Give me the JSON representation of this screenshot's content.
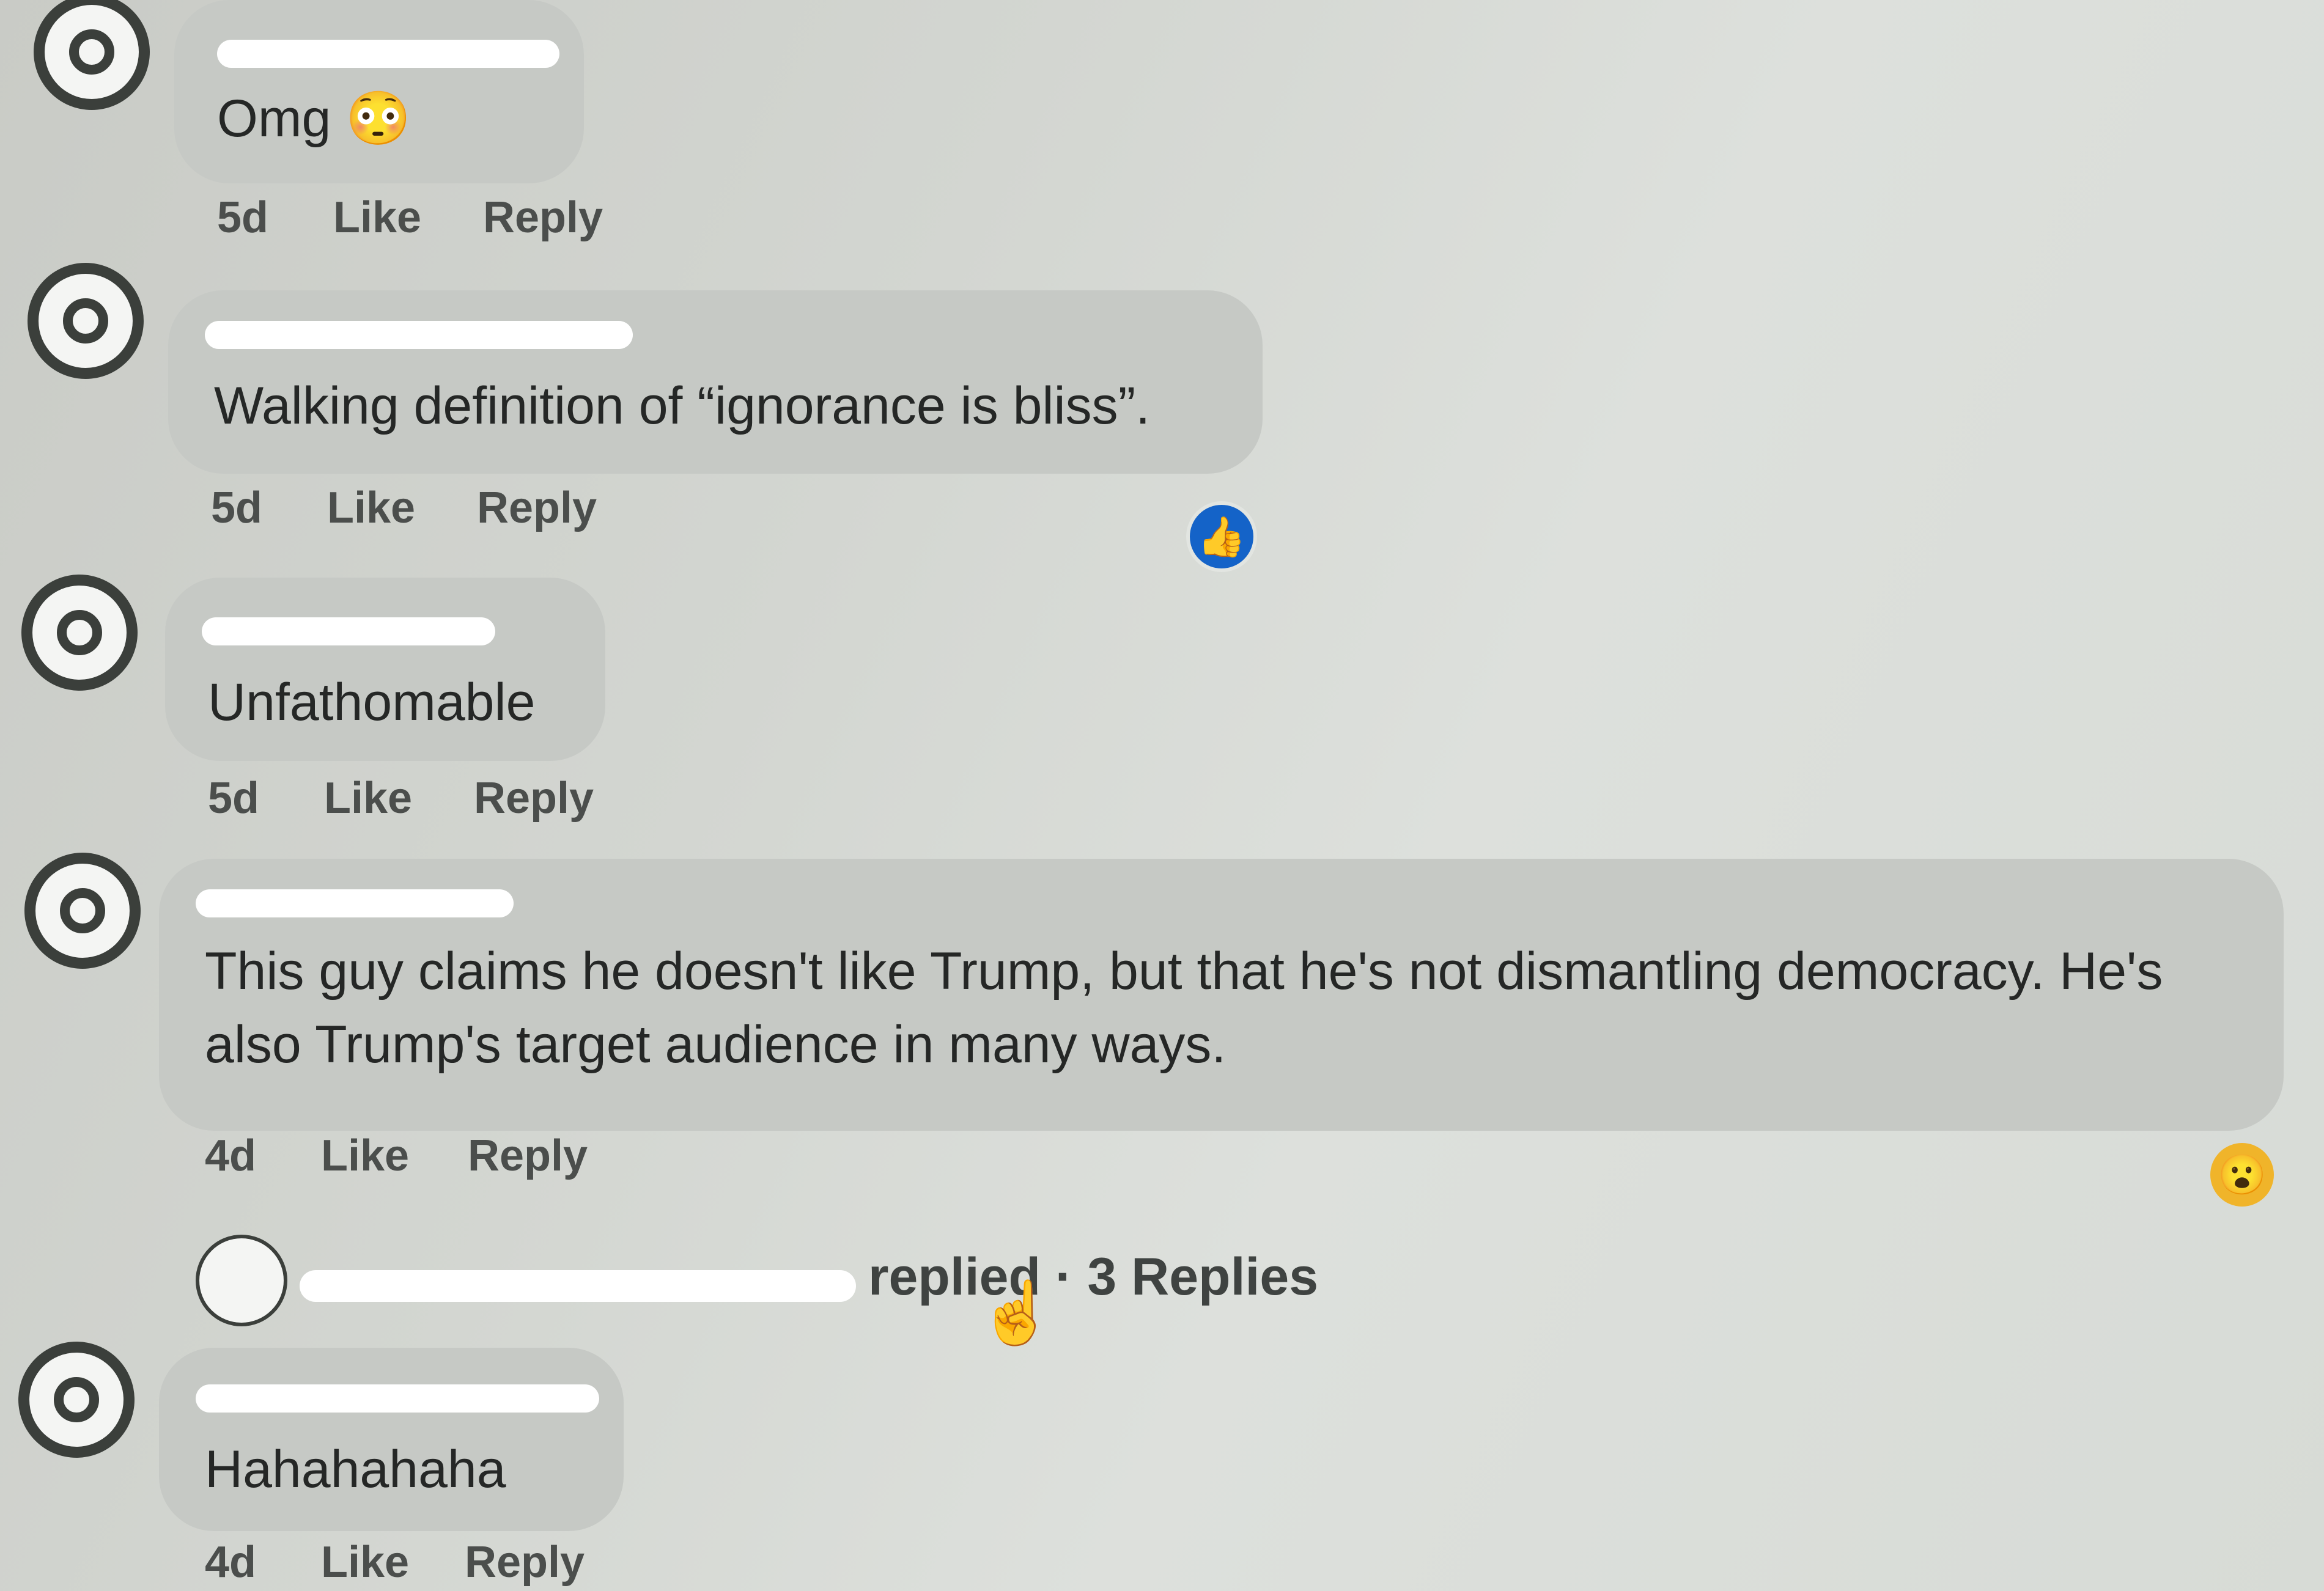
{
  "comments": [
    {
      "text": "Omg 😳",
      "time": "5d",
      "like": "Like",
      "reply": "Reply"
    },
    {
      "text": "Walking definition of “ignorance is bliss”.",
      "time": "5d",
      "like": "Like",
      "reply": "Reply",
      "reaction": "👍"
    },
    {
      "text": "Unfathomable",
      "time": "5d",
      "like": "Like",
      "reply": "Reply"
    },
    {
      "text_line1": "This guy claims he doesn't like Trump, but that he's not dismantling democracy. He's",
      "text_line2": "also Trump's target audience in many ways.",
      "time": "4d",
      "like": "Like",
      "reply": "Reply",
      "reaction": "😮"
    },
    {
      "text": "Hahahahaha",
      "time": "4d",
      "like": "Like",
      "reply": "Reply"
    }
  ],
  "replies_summary": {
    "text": "replied · 3 Replies"
  },
  "icons": {
    "cursor": "hand-pointer-icon",
    "like_reaction": "thumbs-up-icon",
    "wow_reaction": "wow-face-icon"
  },
  "colors": {
    "like_blue": "#1463c8",
    "wow_yellow": "#f0b42a",
    "bubble": "#c6c9c5"
  }
}
